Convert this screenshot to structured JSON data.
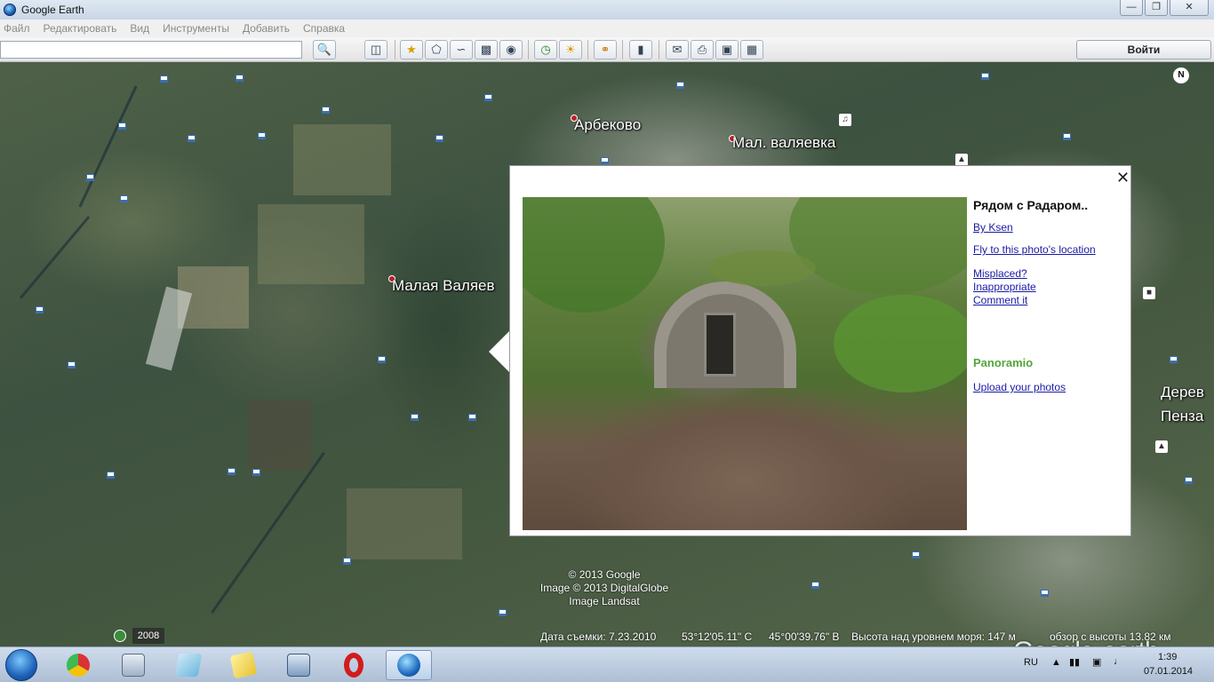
{
  "window": {
    "title": "Google Earth",
    "controls": [
      "—",
      "❐",
      "✕"
    ]
  },
  "menu": [
    "Файл",
    "Редактировать",
    "Вид",
    "Инструменты",
    "Добавить",
    "Справка"
  ],
  "toolbar": {
    "search_value": "",
    "search_icon": "search-icon",
    "login_label": "Войти"
  },
  "map": {
    "labels": {
      "arbekovo": "Арбеково",
      "mal_valyaevka": "Мал. валяевка",
      "malaya_valyaevka": "Малая Валяев",
      "derev": "Дерев",
      "penza": "Пенза"
    },
    "north_label": "N",
    "credits": [
      "© 2013 Google",
      "Image © 2013 DigitalGlobe",
      "Image Landsat"
    ],
    "logo_google": "Google",
    "logo_earth": "earth",
    "year_badge": "2008"
  },
  "popup": {
    "title": "Рядом с Радаром..",
    "author_link": "By Ksen",
    "fly_link": "Fly to this photo's location",
    "misplaced_link": "Misplaced?",
    "inappropriate_link": "Inappropriate",
    "comment_link": "Comment it",
    "brand": "Panoramio",
    "upload_link": "Upload your photos",
    "close_label": "✕"
  },
  "status": {
    "capture_date": "Дата съемки: 7.23.2010",
    "lat": "53°12'05.11\" С",
    "lon": "45°00'39.76\" В",
    "elevation": "Высота над уровнем моря:   147 м",
    "eye_alt": "обзор с высоты   13.82 км"
  },
  "taskbar": {
    "lang": "RU",
    "time": "1:39",
    "date": "07.01.2014"
  }
}
